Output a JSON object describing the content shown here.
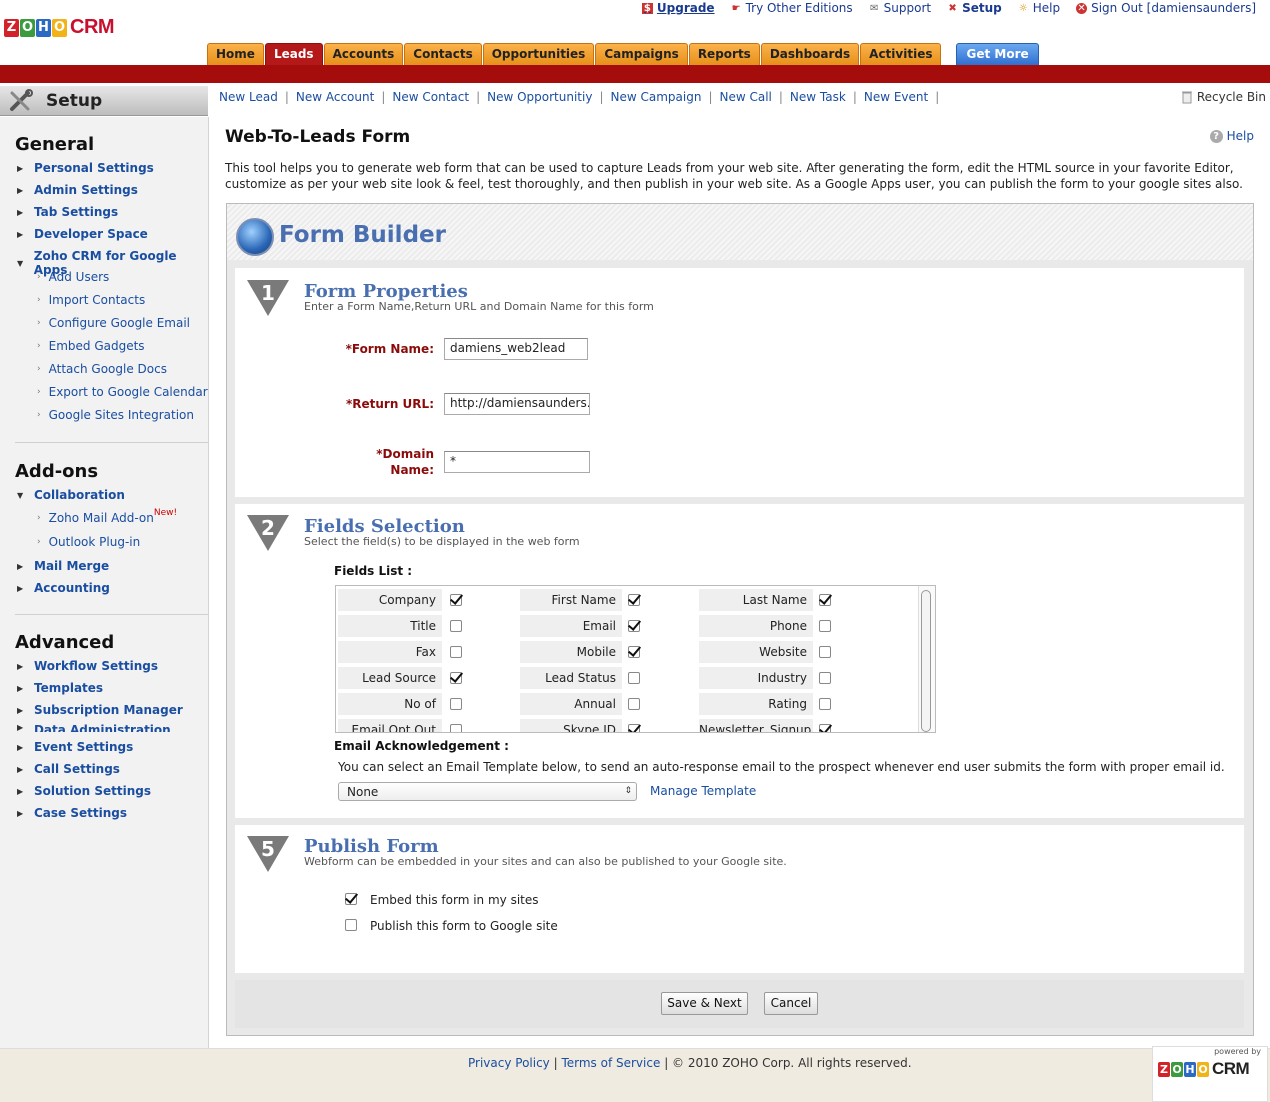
{
  "header": {
    "top_links": [
      "Upgrade",
      "Try Other Editions",
      "Support",
      "Setup",
      "Help",
      "Sign Out [damiensaunders]"
    ],
    "logo": {
      "zoho_letters": [
        "Z",
        "O",
        "H",
        "O"
      ],
      "product": "CRM"
    },
    "tabs": [
      "Home",
      "Leads",
      "Accounts",
      "Contacts",
      "Opportunities",
      "Campaigns",
      "Reports",
      "Dashboards",
      "Activities"
    ],
    "active_tab": "Leads",
    "get_more": "Get More"
  },
  "setup": {
    "title": "Setup"
  },
  "subnav": {
    "links": [
      "New Lead",
      "New Account",
      "New Contact",
      "New Opportunitiy",
      "New Campaign",
      "New Call",
      "New Task",
      "New Event"
    ],
    "recycle_bin": "Recycle Bin"
  },
  "sidebar": {
    "general": {
      "heading": "General",
      "items": [
        "Personal Settings",
        "Admin Settings",
        "Tab Settings",
        "Developer Space",
        "Zoho CRM for Google Apps"
      ],
      "subitems": [
        "Add Users",
        "Import Contacts",
        "Configure Google Email",
        "Embed Gadgets",
        "Attach Google Docs",
        "Export to Google Calendar",
        "Google Sites Integration"
      ]
    },
    "addons": {
      "heading": "Add-ons",
      "collab": "Collaboration",
      "subitems": [
        "Zoho Mail Add-on",
        "Outlook Plug-in"
      ],
      "new_badge": "New!",
      "items": [
        "Mail Merge",
        "Accounting"
      ]
    },
    "advanced": {
      "heading": "Advanced",
      "items": [
        "Workflow Settings",
        "Templates",
        "Subscription Manager",
        "Data Administration Tools",
        "Event Settings",
        "Call Settings",
        "Solution Settings",
        "Case Settings"
      ]
    }
  },
  "main": {
    "title": "Web-To-Leads Form",
    "help": "Help",
    "description": "This tool helps you to generate web form that can be used to capture Leads from your web site. After generating the form, edit the HTML source in your favorite Editor, customize as per your web site look & feel, test thoroughly, and then publish in your web site. As a Google Apps user, you can publish the form to your google sites also.",
    "form_builder": "Form Builder"
  },
  "step1": {
    "num": "1",
    "title": "Form Properties",
    "subtitle": "Enter a Form Name,Return URL and Domain Name for this form",
    "form_name_label": "*Form Name:",
    "form_name_value": "damiens_web2lead",
    "return_url_label": "*Return URL:",
    "return_url_value": "http://damiensaunders.c",
    "domain_label_1": "*Domain",
    "domain_label_2": "Name:",
    "domain_value": "*"
  },
  "step2": {
    "num": "2",
    "title": "Fields Selection",
    "subtitle": "Select the field(s) to be displayed in the web form",
    "fields_list_label": "Fields List :",
    "fields": [
      [
        {
          "label": "Company",
          "checked": true
        },
        {
          "label": "First Name",
          "checked": true
        },
        {
          "label": "Last Name",
          "checked": true
        }
      ],
      [
        {
          "label": "Title",
          "checked": false
        },
        {
          "label": "Email",
          "checked": true
        },
        {
          "label": "Phone",
          "checked": false
        }
      ],
      [
        {
          "label": "Fax",
          "checked": false
        },
        {
          "label": "Mobile",
          "checked": true
        },
        {
          "label": "Website",
          "checked": false
        }
      ],
      [
        {
          "label": "Lead Source",
          "checked": true
        },
        {
          "label": "Lead Status",
          "checked": false
        },
        {
          "label": "Industry",
          "checked": false
        }
      ],
      [
        {
          "label": "No of Employees",
          "checked": false
        },
        {
          "label": "Annual Revenue",
          "checked": false
        },
        {
          "label": "Rating",
          "checked": false
        }
      ],
      [
        {
          "label": "Email Opt Out",
          "checked": false
        },
        {
          "label": "Skype ID",
          "checked": true
        },
        {
          "label": "Newsletter_Signup",
          "checked": true
        }
      ]
    ],
    "email_ack_label": "Email Acknowledgement :",
    "email_ack_desc": "You can select an Email Template below, to send an auto-response email to the prospect whenever end user submits the form with proper email id.",
    "template_select": "None",
    "manage_template": "Manage Template"
  },
  "step5": {
    "num": "5",
    "title": "Publish Form",
    "subtitle": "Webform can be embedded in your sites and can also be published to your Google site.",
    "embed_label": "Embed this form in my sites",
    "embed_checked": true,
    "google_label": "Publish this form to Google site",
    "google_checked": false
  },
  "buttons": {
    "save_next": "Save & Next",
    "cancel": "Cancel"
  },
  "footer": {
    "privacy": "Privacy Policy",
    "terms": "Terms of Service",
    "copyright": "© 2010 ZOHO Corp. All rights reserved.",
    "powered_by": "powered by",
    "logo_product": "CRM"
  },
  "colors": {
    "brand_red": "#a50d0d",
    "tab_orange": "#f0a030",
    "link_blue": "#1a4ea0",
    "heading_blue": "#4a6fb0"
  }
}
